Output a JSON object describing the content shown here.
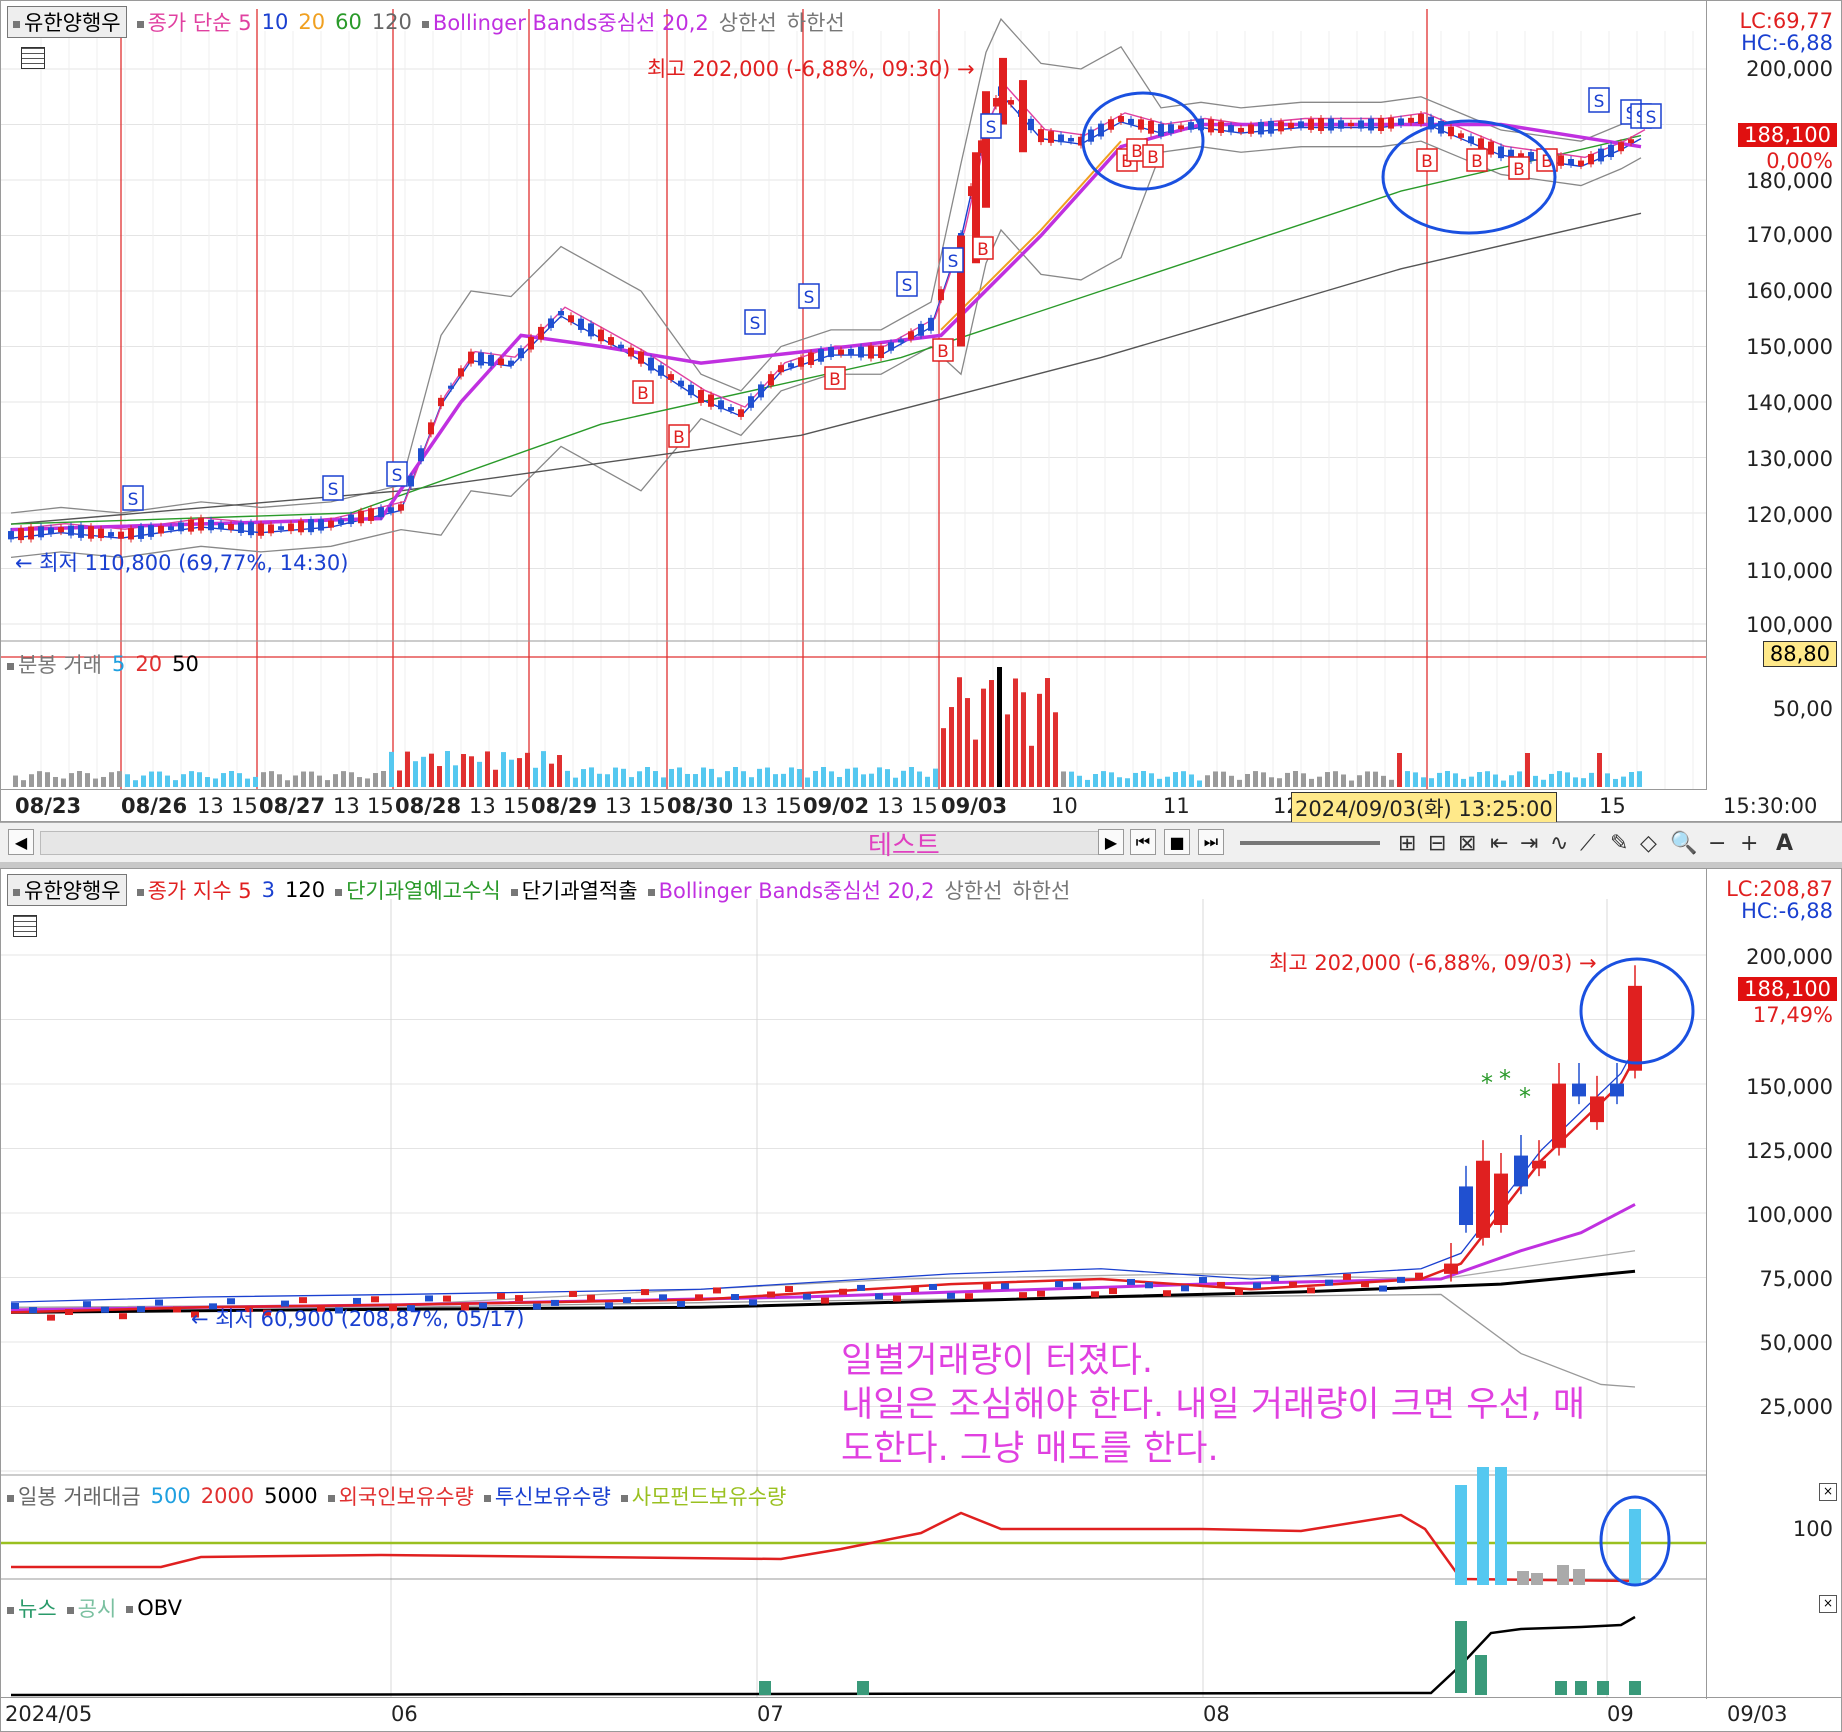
{
  "top_chart": {
    "stock_tag": "유한양행우",
    "legend_close": "종가 단순 5",
    "legend_ma": [
      {
        "label": "10",
        "color": "#1a40d0"
      },
      {
        "label": "20",
        "color": "#f0a020"
      },
      {
        "label": "60",
        "color": "#2a9a2a"
      },
      {
        "label": "120",
        "color": "#666666"
      }
    ],
    "legend_bb": "Bollinger Bands중심선 20,2",
    "legend_upper": "상한선",
    "legend_lower": "하한선",
    "lc": "LC:69,77",
    "hc": "HC:-6,88",
    "high_note": "최고 202,000 (-6,88%, 09:30) →",
    "low_note": "← 최저 110,800 (69,77%, 14:30)",
    "price_box": "188,100",
    "pct_box": "0,00%",
    "y_labels": [
      "200,000",
      "190,000",
      "180,000",
      "170,000",
      "160,000",
      "150,000",
      "140,000",
      "130,000",
      "120,000",
      "110,000",
      "100,000"
    ],
    "x_labels": [
      "08/23",
      "08/26",
      "13",
      "15",
      "08/27",
      "13",
      "15",
      "08/28",
      "13",
      "15",
      "08/29",
      "13",
      "15",
      "08/30",
      "13",
      "15",
      "09/02",
      "13",
      "15",
      "09/03",
      "10",
      "11",
      "12",
      "15"
    ],
    "time_label": "15:30:00",
    "crosshair_label": "2024/09/03(화) 13:25:00",
    "volume_legend_label": "분봉 거래",
    "volume_legend_ma": [
      {
        "label": "5",
        "color": "#1fa0e0"
      },
      {
        "label": "20",
        "color": "#e03030"
      },
      {
        "label": "50",
        "color": "#000000"
      }
    ],
    "volume_box": "88,80",
    "volume_y_label": "50,00",
    "signals_S": 12,
    "signals_B": 12
  },
  "toolbar": {
    "title_overlay": "테스트",
    "tools": [
      "⊞",
      "⊟",
      "⊠",
      "⇤",
      "⇥",
      "∿",
      "⟋",
      "✎",
      "◇",
      "🔍",
      "−",
      "+",
      "A"
    ]
  },
  "bottom_chart": {
    "stock_tag": "유한양행우",
    "legend_close": "종가 지수 5",
    "legend_ma": [
      {
        "label": "3",
        "color": "#1a40d0"
      },
      {
        "label": "120",
        "color": "#000000"
      }
    ],
    "legend_overheat": "단기과열예고수식",
    "legend_overheat2": "단기과열적출",
    "legend_bb": "Bollinger Bands중심선 20,2",
    "legend_upper": "상한선",
    "legend_lower": "하한선",
    "lc": "LC:208,87",
    "hc": "HC:-6,88",
    "high_note": "최고 202,000 (-6,88%, 09/03) →",
    "low_note": "← 최저 60,900 (208,87%, 05/17)",
    "price_box": "188,100",
    "pct_box": "17,49%",
    "y_labels": [
      "200,000",
      "175,000",
      "150,000",
      "125,000",
      "100,000",
      "75,000",
      "50,000",
      "25,000"
    ],
    "note_lines": [
      "일별거래량이 터졌다.",
      "내일은 조심해야 한다.  내일 거래량이 크면 우선, 매",
      "도한다. 그냥 매도를 한다."
    ],
    "vol_legend": [
      {
        "label": "일봉 거래대금",
        "color": "#666666"
      },
      {
        "label": "500",
        "color": "#1fa0e0"
      },
      {
        "label": "2000",
        "color": "#e03030"
      },
      {
        "label": "5000",
        "color": "#000000"
      },
      {
        "label": "외국인보유수량",
        "color": "#e03030"
      },
      {
        "label": "투신보유수량",
        "color": "#1a40d0"
      },
      {
        "label": "사모펀드보유수량",
        "color": "#9ac020"
      }
    ],
    "vol_y_label": "100",
    "obv_legend": [
      {
        "label": "뉴스",
        "color": "#2a9a6a"
      },
      {
        "label": "공시",
        "color": "#7ac0a0"
      },
      {
        "label": "OBV",
        "color": "#000000"
      }
    ],
    "x_labels": [
      "2024/05",
      "06",
      "07",
      "08",
      "09"
    ],
    "date_label": "09/03"
  },
  "colors": {
    "up": "#e02020",
    "down": "#2050d0",
    "bb_mid": "#c030e0",
    "annotation": "#e040e0",
    "circle": "#1a50e0"
  }
}
